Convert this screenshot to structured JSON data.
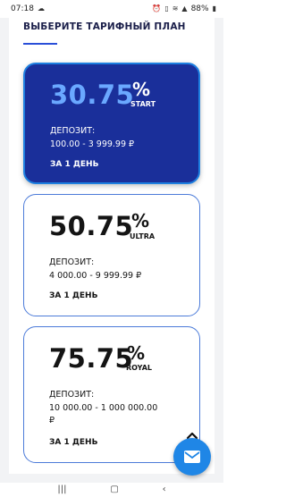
{
  "status_bar": {
    "time": "07:18",
    "battery": "88%",
    "icons": [
      "cloud-icon",
      "alarm-icon",
      "vibrate-icon",
      "wifi-icon",
      "signal-icon",
      "battery-icon"
    ]
  },
  "section": {
    "title": "ВЫБЕРИТЕ ТАРИФНЫЙ ПЛАН"
  },
  "plans": [
    {
      "rate": "30.75",
      "percent": "%",
      "name": "START",
      "deposit_label": "ДЕПОЗИТ:",
      "deposit_range": "100.00 - 3 999.99 ₽",
      "period": "ЗА 1 ДЕНЬ",
      "selected": true
    },
    {
      "rate": "50.75",
      "percent": "%",
      "name": "ULTRA",
      "deposit_label": "ДЕПОЗИТ:",
      "deposit_range": "4 000.00 - 9 999.99 ₽",
      "period": "ЗА 1 ДЕНЬ",
      "selected": false
    },
    {
      "rate": "75.75",
      "percent": "%",
      "name": "ROYAL",
      "deposit_label": "ДЕПОЗИТ:",
      "deposit_range_line1": "10 000.00 - 1 000 000.00",
      "deposit_range_line2": "₽",
      "period": "ЗА 1 ДЕНЬ",
      "selected": false
    }
  ],
  "colors": {
    "accent": "#1a2f9a",
    "accent_border": "#1d7fe0",
    "rate_highlight": "#6aa8ff",
    "card_border": "#4c7bd9",
    "fab": "#1f86e6"
  }
}
